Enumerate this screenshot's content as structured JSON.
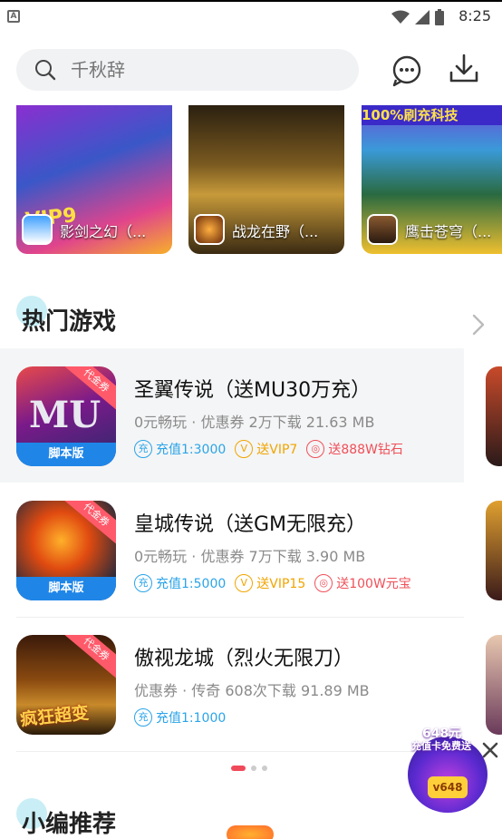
{
  "status_bar": {
    "time": "8:25"
  },
  "search": {
    "placeholder": "千秋辞"
  },
  "banners": [
    {
      "name": "影剑之幻（..."
    },
    {
      "name": "战龙在野（..."
    },
    {
      "name": "鹰击苍穹（..."
    }
  ],
  "hot_section": {
    "title": "热门游戏"
  },
  "games": [
    {
      "name": "圣翼传说（送MU30万充）",
      "meta": "0元畅玩 · 优惠券  2万下载  21.63 MB",
      "icon_tag": "代金券",
      "icon_bar": "脚本版",
      "perks": [
        {
          "icon": "充",
          "text": "充值1:3000"
        },
        {
          "icon": "V",
          "text": "送VIP7"
        },
        {
          "icon": "◎",
          "text": "送888W钻石"
        }
      ]
    },
    {
      "name": "皇城传说（送GM无限充）",
      "meta": "0元畅玩 · 优惠券  7万下载  3.90 MB",
      "icon_tag": "代金券",
      "icon_bar": "脚本版",
      "perks": [
        {
          "icon": "充",
          "text": "充值1:5000"
        },
        {
          "icon": "V",
          "text": "送VIP15"
        },
        {
          "icon": "◎",
          "text": "送100W元宝"
        }
      ]
    },
    {
      "name": "傲视龙城（烈火无限刀）",
      "meta": "优惠券 · 传奇  608次下载  91.89 MB",
      "icon_tag": "代金券",
      "icon_art_text": "疯狂超变",
      "perks": [
        {
          "icon": "充",
          "text": "充值1:1000"
        }
      ]
    }
  ],
  "editor_section": {
    "title": "小编推荐"
  },
  "float_ad": {
    "line1": "648元",
    "line2": "充值卡免费送",
    "badge": "v648"
  },
  "colors": {
    "accent_red": "#f04a5a",
    "blue": "#2aa4e8",
    "gold": "#f0a500",
    "red": "#f0505a"
  }
}
